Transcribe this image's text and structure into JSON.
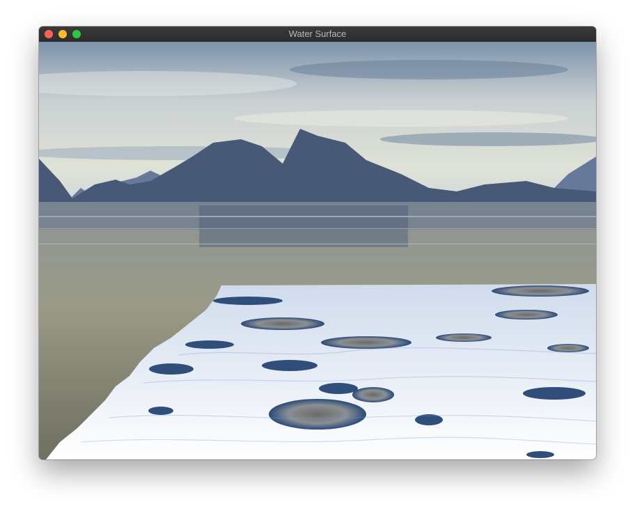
{
  "window": {
    "title": "Water Surface",
    "controls": {
      "close_color": "#fe5f57",
      "minimize_color": "#febc2e",
      "maximize_color": "#28c840"
    }
  },
  "scene": {
    "description_colors": {
      "sky_top": "#6f8aa6",
      "sky_horizon": "#d9dccf",
      "mountain": "#4a5a78",
      "water": "#8a8f86",
      "ice_surface": "#eef3fb",
      "ice_holes": "#2f4f7a"
    }
  }
}
